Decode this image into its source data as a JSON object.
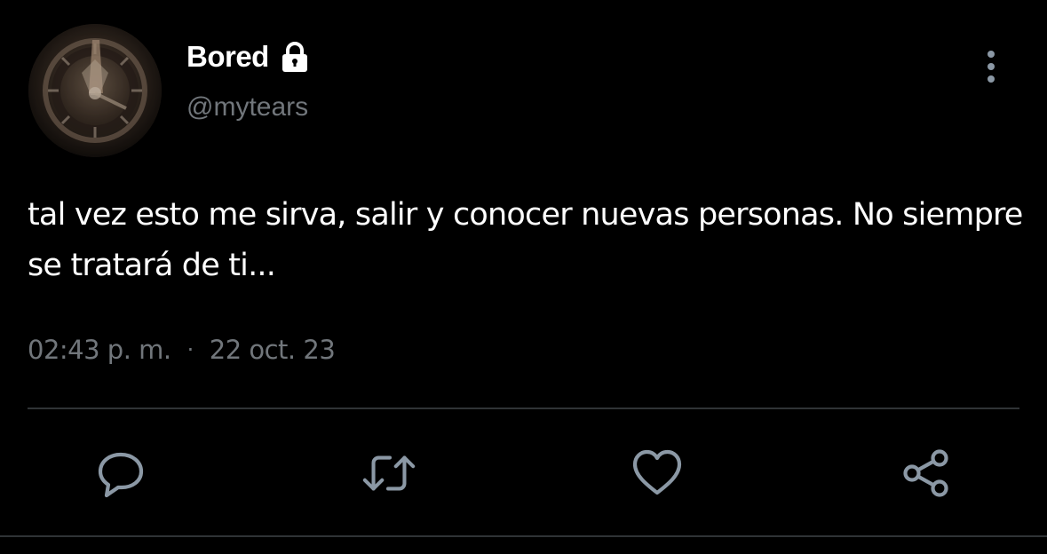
{
  "tweet": {
    "author": {
      "display_name": "Bored",
      "handle": "@mytears",
      "protected_icon": "lock-icon",
      "avatar_icon": "clock-avatar"
    },
    "text": "tal vez esto me sirva, salir y conocer nuevas personas. No siempre se tratará de ti...",
    "time": "02:43 p. m.",
    "separator": "·",
    "date": "22 oct. 23"
  },
  "actions": [
    {
      "name": "reply",
      "icon": "reply-icon"
    },
    {
      "name": "retweet",
      "icon": "retweet-icon"
    },
    {
      "name": "like",
      "icon": "heart-icon"
    },
    {
      "name": "share",
      "icon": "share-icon"
    }
  ],
  "menu": {
    "icon": "more-vertical-icon"
  },
  "colors": {
    "background": "#000000",
    "text_primary": "#ffffff",
    "text_secondary": "#71767b",
    "icon": "#8b98a5",
    "divider": "#2f3336"
  }
}
